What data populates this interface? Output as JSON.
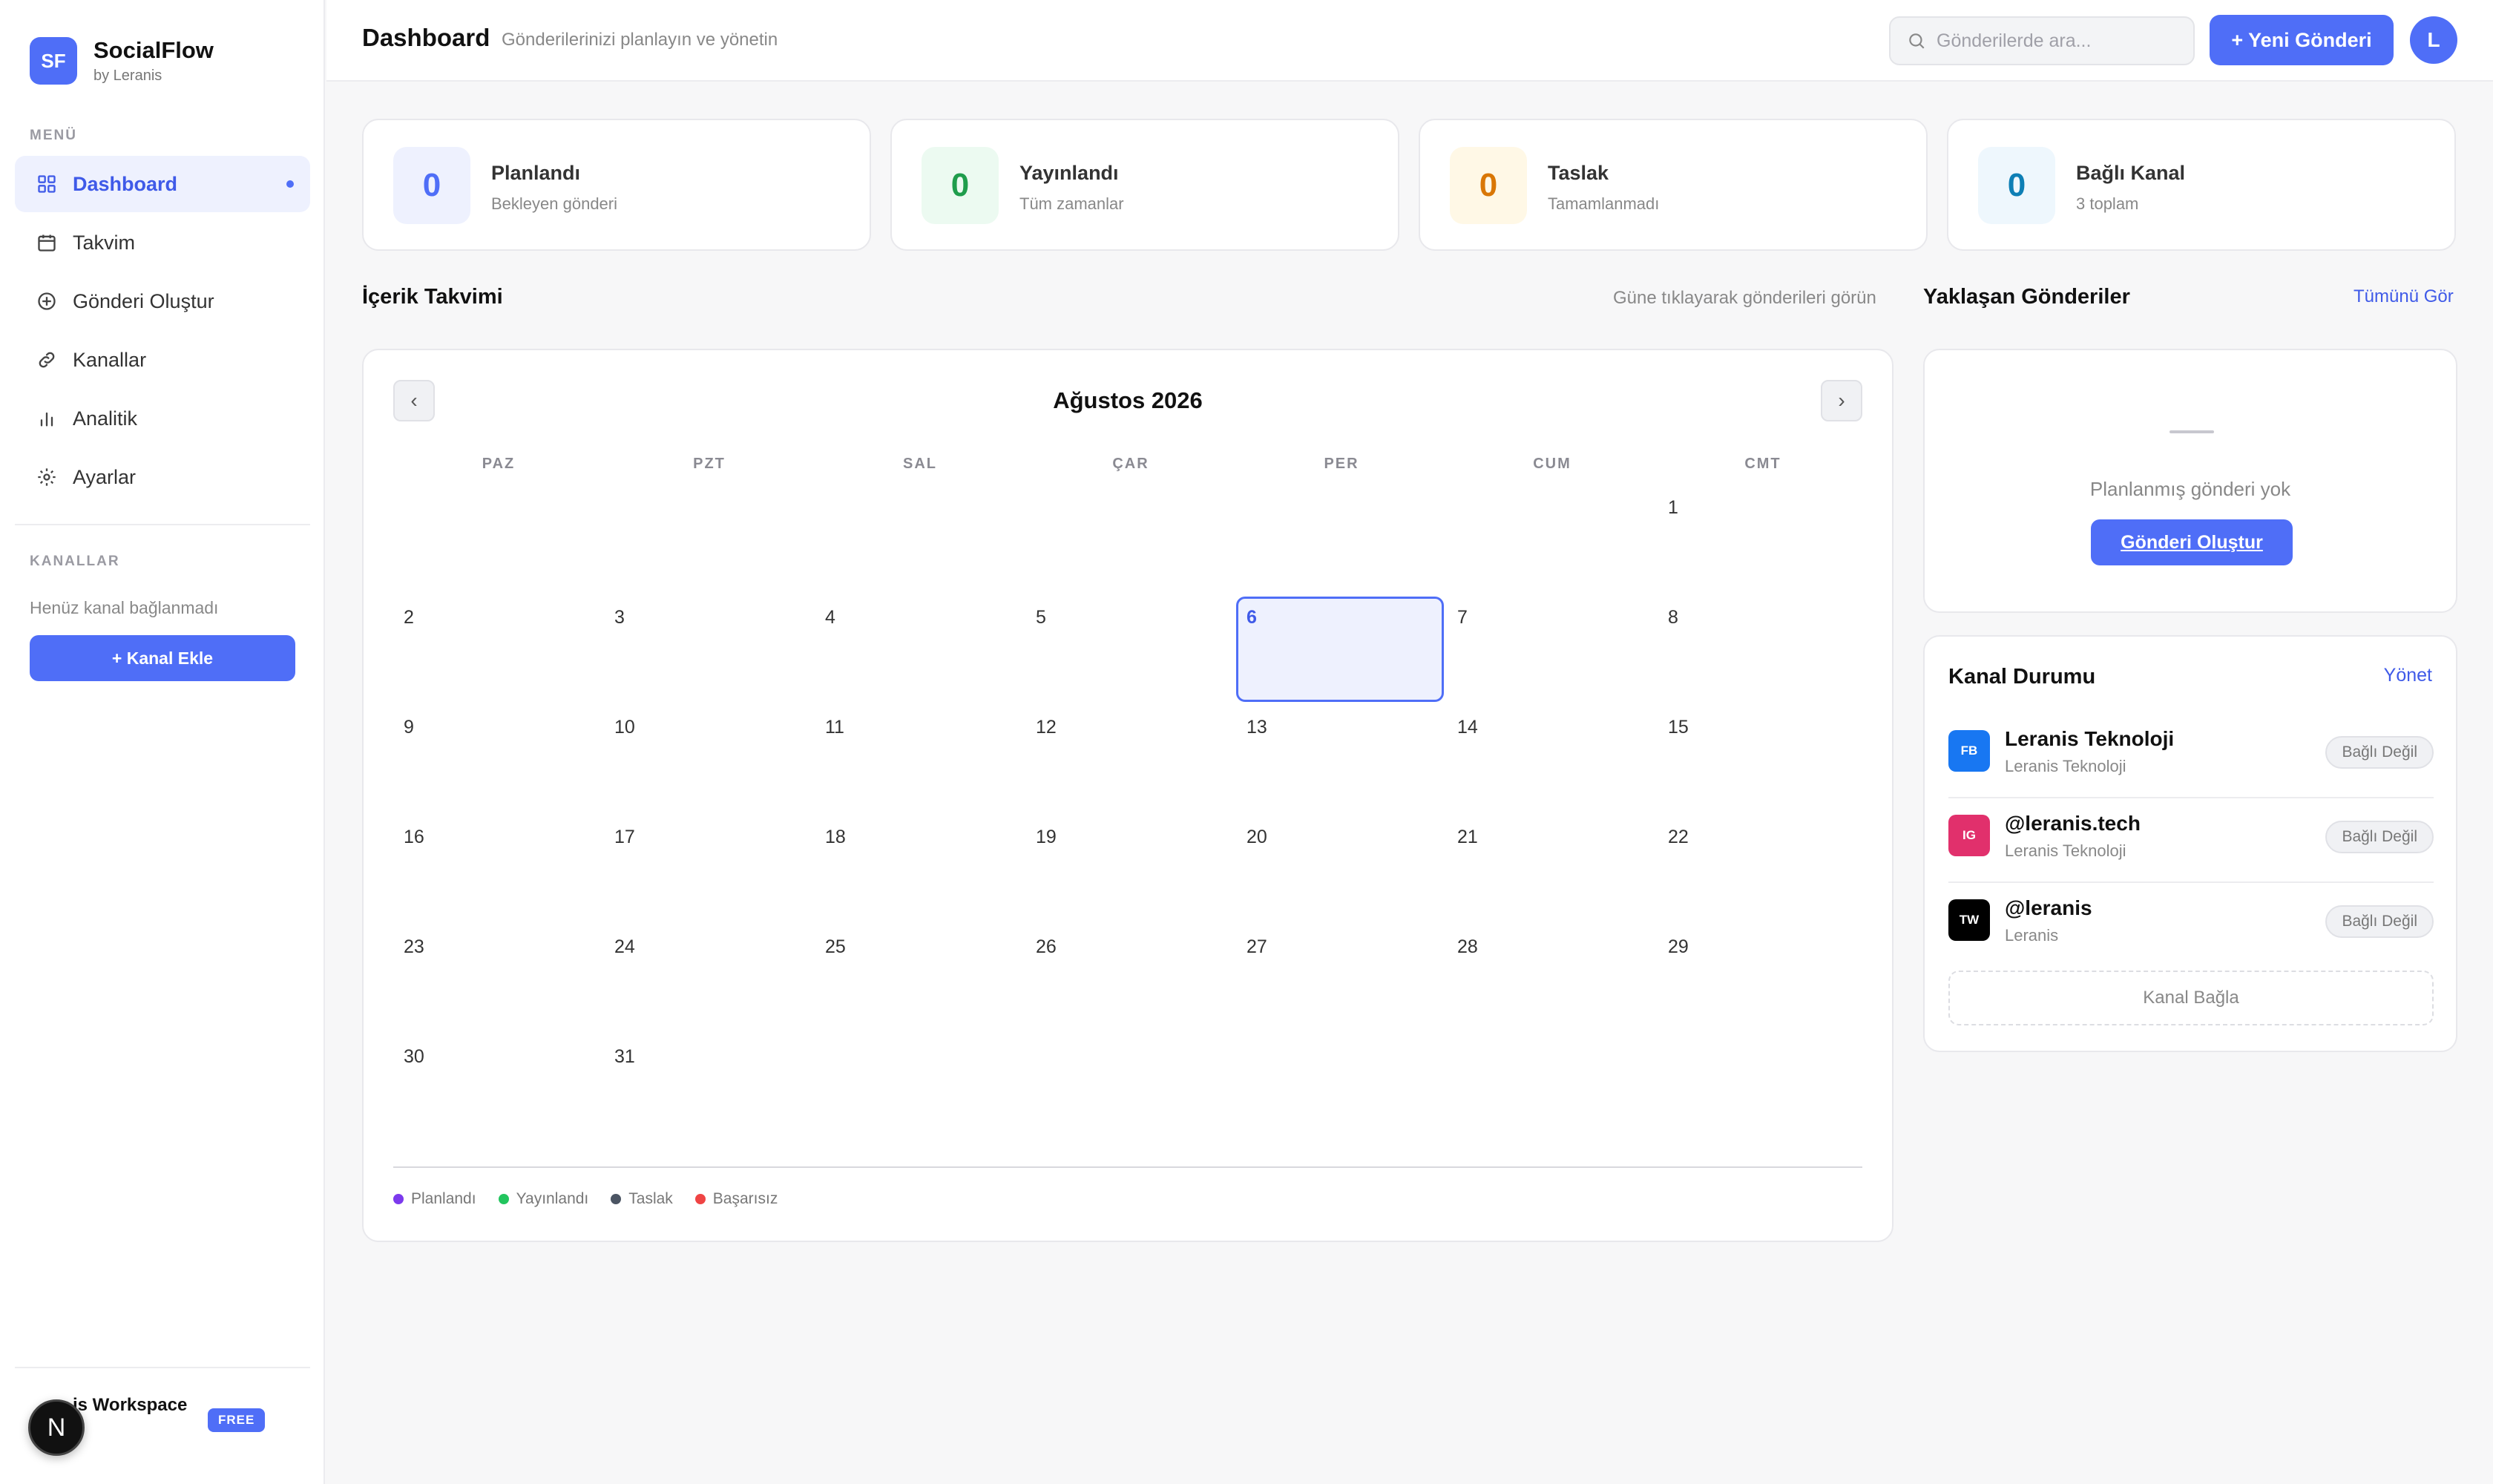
{
  "app": {
    "logo_text": "SF",
    "name": "SocialFlow",
    "by": "by Leranis"
  },
  "sidebar": {
    "menu_label": "MENÜ",
    "items": [
      {
        "label": "Dashboard",
        "icon": "grid-icon",
        "active": true
      },
      {
        "label": "Takvim",
        "icon": "calendar-icon"
      },
      {
        "label": "Gönderi Oluştur",
        "icon": "plus-circle-icon"
      },
      {
        "label": "Kanallar",
        "icon": "link-icon"
      },
      {
        "label": "Analitik",
        "icon": "bar-chart-icon"
      },
      {
        "label": "Ayarlar",
        "icon": "gear-icon"
      }
    ],
    "channels_label": "KANALLAR",
    "no_channel_text": "Henüz kanal bağlanmadı",
    "add_channel_label": "+ Kanal Ekle",
    "workspace_name": "is Workspace",
    "workspace_badge": "FREE",
    "n_avatar": "N"
  },
  "header": {
    "title": "Dashboard",
    "subtitle": "Gönderilerinizi planlayın ve yönetin",
    "search_placeholder": "Gönderilerde ara...",
    "new_post_label": "+ Yeni Gönderi",
    "avatar_letter": "L"
  },
  "stats": [
    {
      "value": "0",
      "title": "Planlandı",
      "sub": "Bekleyen gönderi",
      "color": "#4f6ef7",
      "bg": "#eef1fe"
    },
    {
      "value": "0",
      "title": "Yayınlandı",
      "sub": "Tüm zamanlar",
      "color": "#1f9d4c",
      "bg": "#ecfaf1"
    },
    {
      "value": "0",
      "title": "Taslak",
      "sub": "Tamamlanmadı",
      "color": "#d97706",
      "bg": "#fff8e6"
    },
    {
      "value": "0",
      "title": "Bağlı Kanal",
      "sub": "3 toplam",
      "color": "#0e7fb5",
      "bg": "#eef7fd"
    }
  ],
  "calendar": {
    "section_title": "İçerik Takvimi",
    "hint": "Güne tıklayarak gönderileri görün",
    "prev_label": "‹",
    "next_label": "›",
    "month_label": "Ağustos 2026",
    "weekdays": [
      "PAZ",
      "PZT",
      "SAL",
      "ÇAR",
      "PER",
      "CUM",
      "CMT"
    ],
    "first_weekday_index": 6,
    "days_in_month": 31,
    "today": 6,
    "legend": [
      {
        "label": "Planlandı",
        "color": "#7c3aed"
      },
      {
        "label": "Yayınlandı",
        "color": "#22c55e"
      },
      {
        "label": "Taslak",
        "color": "#4b5563"
      },
      {
        "label": "Başarısız",
        "color": "#ef4444"
      }
    ]
  },
  "upcoming": {
    "title": "Yaklaşan Gönderiler",
    "see_all": "Tümünü Gör",
    "empty_text": "Planlanmış gönderi yok",
    "create_label": "Gönderi Oluştur"
  },
  "channel_status": {
    "title": "Kanal Durumu",
    "manage_label": "Yönet",
    "channels": [
      {
        "abbr": "FB",
        "name": "Leranis Teknoloji",
        "sub": "Leranis Teknoloji",
        "status": "Bağlı Değil",
        "color": "#1877f2"
      },
      {
        "abbr": "IG",
        "name": "@leranis.tech",
        "sub": "Leranis Teknoloji",
        "status": "Bağlı Değil",
        "color": "#e1306c"
      },
      {
        "abbr": "TW",
        "name": "@leranis",
        "sub": "Leranis",
        "status": "Bağlı Değil",
        "color": "#000000"
      }
    ],
    "connect_label": "Kanal Bağla"
  }
}
